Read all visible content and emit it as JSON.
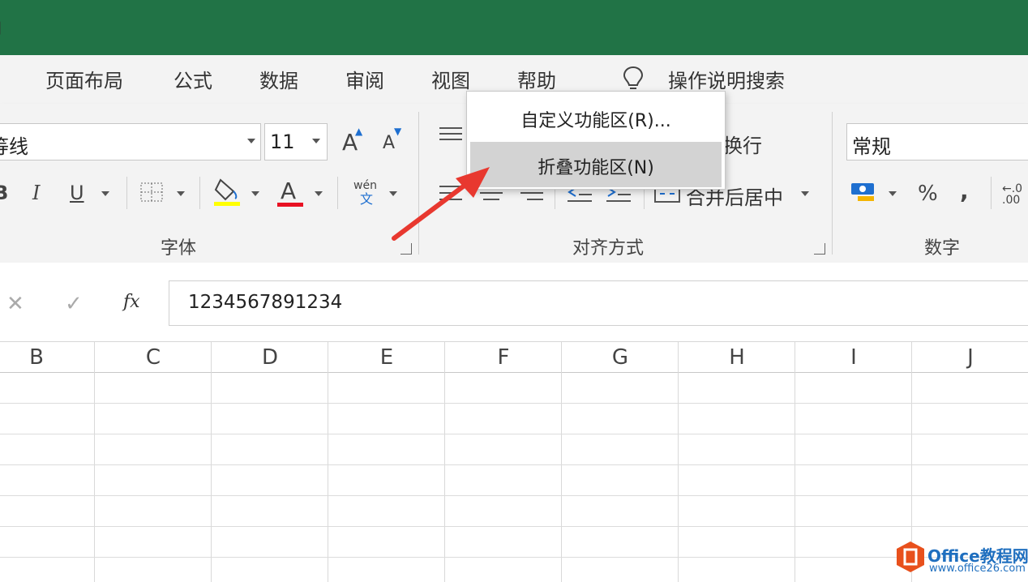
{
  "tabs": {
    "cut_left": "」",
    "items": [
      "页面布局",
      "公式",
      "数据",
      "审阅",
      "视图",
      "帮助"
    ],
    "tell_me": "操作说明搜索"
  },
  "font_group": {
    "font_name": "等线",
    "font_size": "11",
    "grow_label": "A",
    "shrink_label": "A",
    "bold": "B",
    "italic": "I",
    "underline": "U",
    "font_color_label": "A",
    "phonetic_label": "wén",
    "phonetic_sub": "文",
    "group_label": "字体"
  },
  "alignment_group": {
    "wrap_text": "换行",
    "merge_center": "合并后居中",
    "group_label": "对齐方式"
  },
  "number_group": {
    "format": "常规",
    "percent": "%",
    "comma": ",",
    "decimal": "←.0\n.00",
    "group_label": "数字"
  },
  "formula_bar": {
    "cancel": "✕",
    "enter": "✓",
    "fx": "fx",
    "value": "1234567891234"
  },
  "columns": [
    "B",
    "C",
    "D",
    "E",
    "F",
    "G",
    "H",
    "I",
    "J"
  ],
  "context_menu": {
    "items": [
      {
        "label": "自定义功能区(R)...",
        "highlighted": false
      },
      {
        "label": "折叠功能区(N)",
        "highlighted": true
      }
    ]
  },
  "watermark": {
    "title": "Office教程网",
    "url": "www.office26.com"
  },
  "colors": {
    "title_bar": "#217346",
    "highlight_fill": "#ffff00",
    "font_color": "#e81123",
    "arrow": "#e8382f",
    "watermark_orange": "#e8501c"
  }
}
